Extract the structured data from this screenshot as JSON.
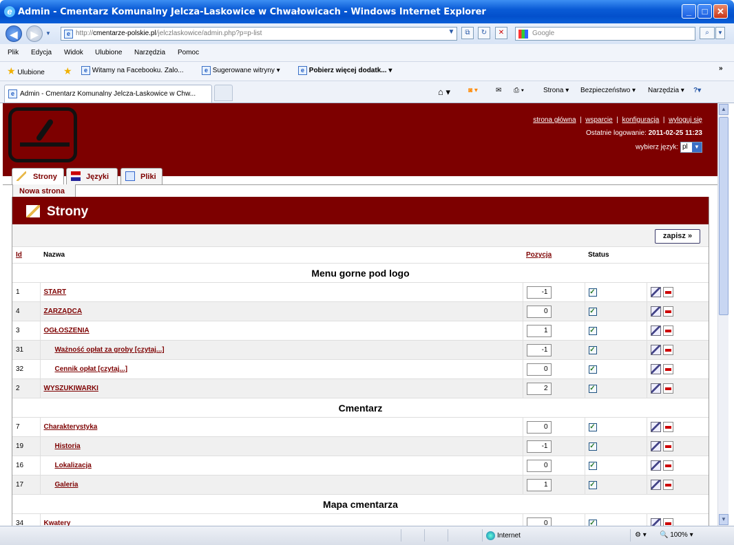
{
  "window": {
    "title": "Admin - Cmentarz Komunalny Jelcza-Laskowice w Chwałowicach - Windows Internet Explorer",
    "minimize": "_",
    "maximize": "□",
    "close": "✕"
  },
  "address": {
    "url_prefix": "http://",
    "url_host": "cmentarze-polskie.pl",
    "url_path": "/jelczlaskowice/admin.php?p=p-list",
    "search_placeholder": "Google"
  },
  "menu": [
    "Plik",
    "Edycja",
    "Widok",
    "Ulubione",
    "Narzędzia",
    "Pomoc"
  ],
  "favorites": {
    "label": "Ulubione",
    "items": [
      "Witamy na Facebooku. Zalo...",
      "Sugerowane witryny ▾",
      "Pobierz więcej dodatk... ▾"
    ]
  },
  "browser_tab": {
    "label": "Admin - Cmentarz Komunalny Jelcza-Laskowice w Chw..."
  },
  "commandbar": {
    "strona": "Strona ▾",
    "bezpieczenstwo": "Bezpieczeństwo ▾",
    "narzedzia": "Narzędzia ▾"
  },
  "header": {
    "links": [
      "strona główna",
      "wsparcie",
      "konfiguracja",
      "wyloguj się"
    ],
    "last_login_label": "Ostatnie logowanie:",
    "last_login_value": "2011-02-25 11:23",
    "language_label": "wybierz język:",
    "language_value": "pl"
  },
  "tabs": [
    "Strony",
    "Języki",
    "Pliki"
  ],
  "subtab": "Nowa strona",
  "panel": {
    "title": "Strony",
    "save_label": "zapisz »"
  },
  "table": {
    "columns": [
      "Id",
      "Nazwa",
      "Pozycja",
      "Status"
    ],
    "groups": [
      {
        "name": "Menu gorne pod logo",
        "rows": [
          {
            "id": "1",
            "name": "START",
            "sub": false,
            "pos": "-1"
          },
          {
            "id": "4",
            "name": "ZARZĄDCA",
            "sub": false,
            "pos": "0"
          },
          {
            "id": "3",
            "name": "OGŁOSZENIA",
            "sub": false,
            "pos": "1"
          },
          {
            "id": "31",
            "name": "Ważność opłat za groby [czytaj...]",
            "sub": true,
            "pos": "-1"
          },
          {
            "id": "32",
            "name": "Cennik opłat [czytaj...]",
            "sub": true,
            "pos": "0"
          },
          {
            "id": "2",
            "name": "WYSZUKIWARKI",
            "sub": false,
            "pos": "2"
          }
        ]
      },
      {
        "name": "Cmentarz",
        "rows": [
          {
            "id": "7",
            "name": "Charakterystyka",
            "sub": false,
            "pos": "0"
          },
          {
            "id": "19",
            "name": "Historia",
            "sub": true,
            "pos": "-1"
          },
          {
            "id": "16",
            "name": "Lokalizacja",
            "sub": true,
            "pos": "0"
          },
          {
            "id": "17",
            "name": "Galeria",
            "sub": true,
            "pos": "1"
          }
        ]
      },
      {
        "name": "Mapa cmentarza",
        "rows": [
          {
            "id": "34",
            "name": "Kwatery",
            "sub": false,
            "pos": "0"
          }
        ]
      }
    ]
  },
  "statusbar": {
    "zone": "Internet",
    "zoom": "100%"
  }
}
